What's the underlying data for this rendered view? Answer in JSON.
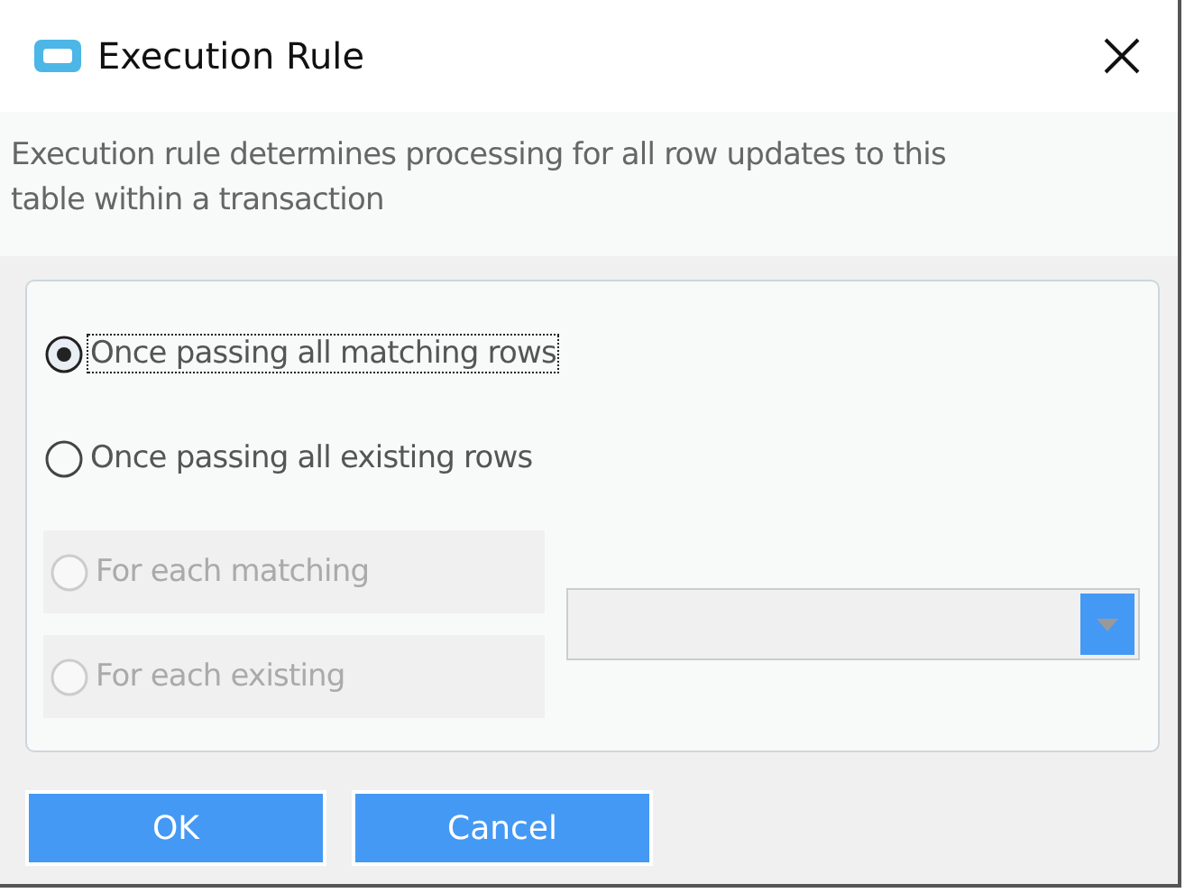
{
  "window": {
    "title": "Execution Rule"
  },
  "description": "Execution rule determines processing for all row updates to this table within a transaction",
  "options": [
    {
      "label": "Once passing all matching rows",
      "selected": true,
      "disabled": false,
      "focused": true
    },
    {
      "label": "Once passing all existing rows",
      "selected": false,
      "disabled": false,
      "focused": false
    }
  ],
  "per_row_options": [
    {
      "label": "For each matching",
      "selected": false,
      "disabled": true,
      "focused": false
    },
    {
      "label": "For each existing",
      "selected": false,
      "disabled": true,
      "focused": false
    }
  ],
  "dropdown": {
    "disabled": true
  },
  "buttons": [
    "OK",
    "Cancel"
  ]
}
